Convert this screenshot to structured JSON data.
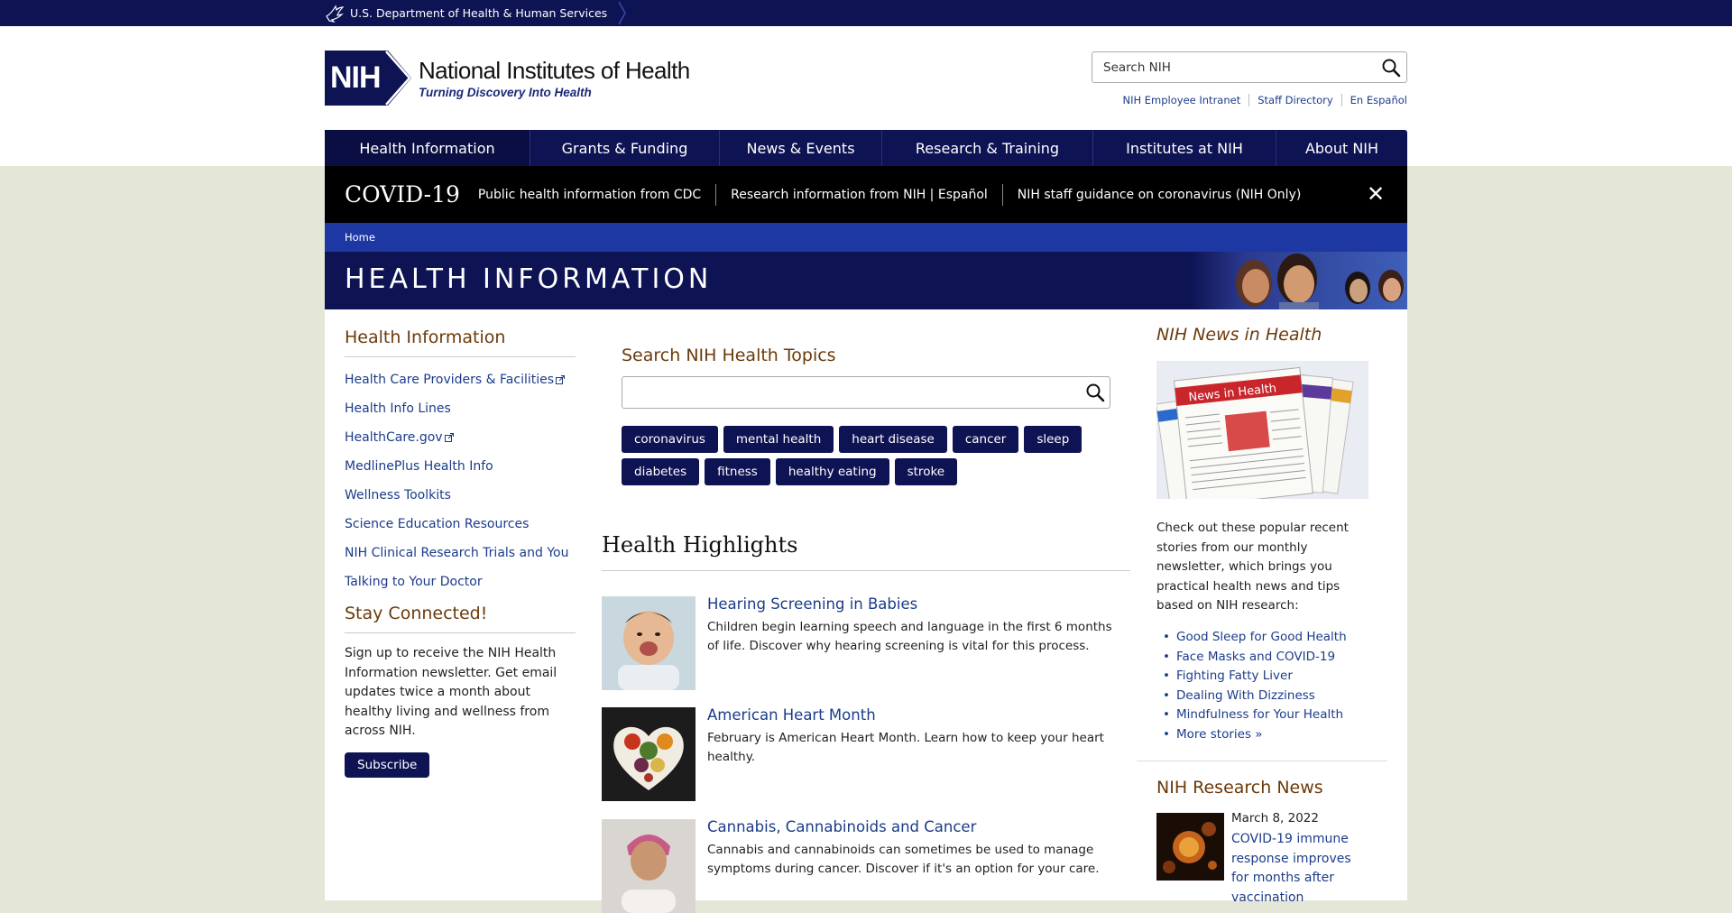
{
  "hhs": {
    "label": "U.S. Department of Health & Human Services"
  },
  "logo": {
    "abbr": "NIH",
    "title": "National Institutes of Health",
    "tagline": "Turning Discovery Into Health"
  },
  "search": {
    "placeholder": "Search NIH"
  },
  "utility_links": [
    "NIH Employee Intranet",
    "Staff Directory",
    "En Español"
  ],
  "nav": {
    "items": [
      {
        "label": "Health Information",
        "active": true
      },
      {
        "label": "Grants & Funding"
      },
      {
        "label": "News & Events"
      },
      {
        "label": "Research & Training"
      },
      {
        "label": "Institutes at NIH"
      },
      {
        "label": "About NIH"
      }
    ]
  },
  "covid": {
    "title": "COVID-19",
    "links": [
      "Public health information from CDC",
      "Research information from NIH | Español",
      "NIH staff guidance on coronavirus (NIH Only)"
    ],
    "close": "✕"
  },
  "breadcrumb": {
    "home": "Home"
  },
  "banner": {
    "title": "HEALTH INFORMATION"
  },
  "left": {
    "heading": "Health Information",
    "links": [
      {
        "label": "Health Care Providers & Facilities",
        "external": true
      },
      {
        "label": "Health Info Lines"
      },
      {
        "label": "HealthCare.gov",
        "external": true
      },
      {
        "label": "MedlinePlus Health Info"
      },
      {
        "label": "Wellness Toolkits"
      },
      {
        "label": "Science Education Resources"
      },
      {
        "label": "NIH Clinical Research Trials and You"
      },
      {
        "label": "Talking to Your Doctor"
      }
    ],
    "stay_heading": "Stay Connected!",
    "stay_text": "Sign up to receive the NIH Health Information newsletter. Get email updates twice a month about healthy living and wellness from across NIH.",
    "subscribe": "Subscribe"
  },
  "topics": {
    "heading": "Search NIH Health Topics",
    "tags": [
      "coronavirus",
      "mental health",
      "heart disease",
      "cancer",
      "sleep",
      "diabetes",
      "fitness",
      "healthy eating",
      "stroke"
    ]
  },
  "highlights": {
    "heading": "Health Highlights",
    "items": [
      {
        "title": "Hearing Screening in Babies",
        "desc": "Children begin learning speech and language in the first 6 months of life. Discover why hearing screening is vital for this process."
      },
      {
        "title": "American Heart Month",
        "desc": "February is American Heart Month. Learn how to keep your heart healthy."
      },
      {
        "title": "Cannabis, Cannabinoids and Cancer",
        "desc": "Cannabis and cannabinoids can sometimes be used to manage symptoms during cancer. Discover if it's an option for your care."
      }
    ]
  },
  "news_in_health": {
    "heading": "NIH News in Health",
    "image_text": "News in Health",
    "intro": "Check out these popular recent stories from our monthly newsletter, which brings you practical health news and tips based on NIH research:",
    "stories": [
      "Good Sleep for Good Health",
      "Face Masks and COVID-19",
      "Fighting Fatty Liver",
      "Dealing With Dizziness",
      "Mindfulness for Your Health",
      "More stories »"
    ]
  },
  "research_news": {
    "heading": "NIH Research News",
    "date": "March 8, 2022",
    "title": "COVID-19 immune response improves for months after vaccination"
  },
  "colors": {
    "navy": "#0e1353",
    "breadcrumb_blue": "#1d38a3",
    "link_blue": "#1b3c8a",
    "heading_brown": "#6b3a0b",
    "page_bg": "#e4e6d8"
  }
}
